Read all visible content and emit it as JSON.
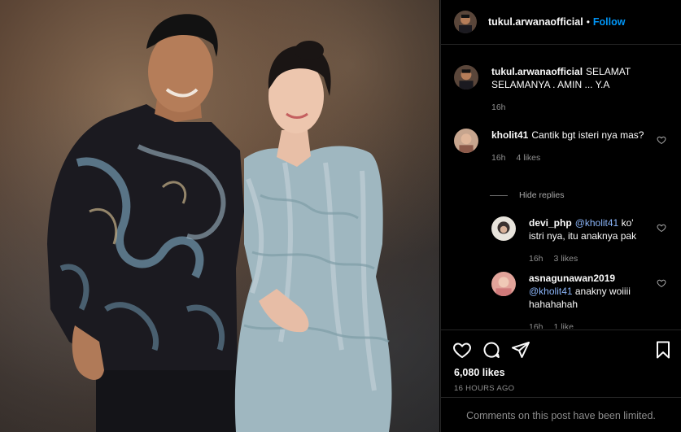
{
  "post": {
    "author": "tukul.arwanaofficial",
    "follow_label": "Follow",
    "dot": "•",
    "caption_text": "SELAMAT SELAMANYA . AMIN ... Y.A",
    "caption_time": "16h"
  },
  "comments": [
    {
      "username": "kholit41",
      "text": "Cantik bgt isteri nya mas?",
      "time": "16h",
      "likes": "4 likes"
    },
    {
      "username": "devi_php",
      "mention": "@kholit41",
      "text": " ko' istri nya, itu anaknya pak",
      "time": "16h",
      "likes": "3 likes"
    },
    {
      "username": "asnagunawan2019",
      "mention": "@kholit41",
      "text": " anakny woiiii hahahahah",
      "time": "16h",
      "likes": "1 like"
    }
  ],
  "hide_replies_label": "Hide replies",
  "likes_count": "6,080 likes",
  "time_ago": "16 HOURS AGO",
  "comments_limited": "Comments on this post have been limited.",
  "icons": [
    "heart-icon",
    "comment-icon",
    "share-icon",
    "bookmark-icon"
  ],
  "colors": {
    "accent": "#0095f6",
    "mention": "#8ab4f8",
    "muted": "#8e8e8e",
    "background": "#000000"
  }
}
